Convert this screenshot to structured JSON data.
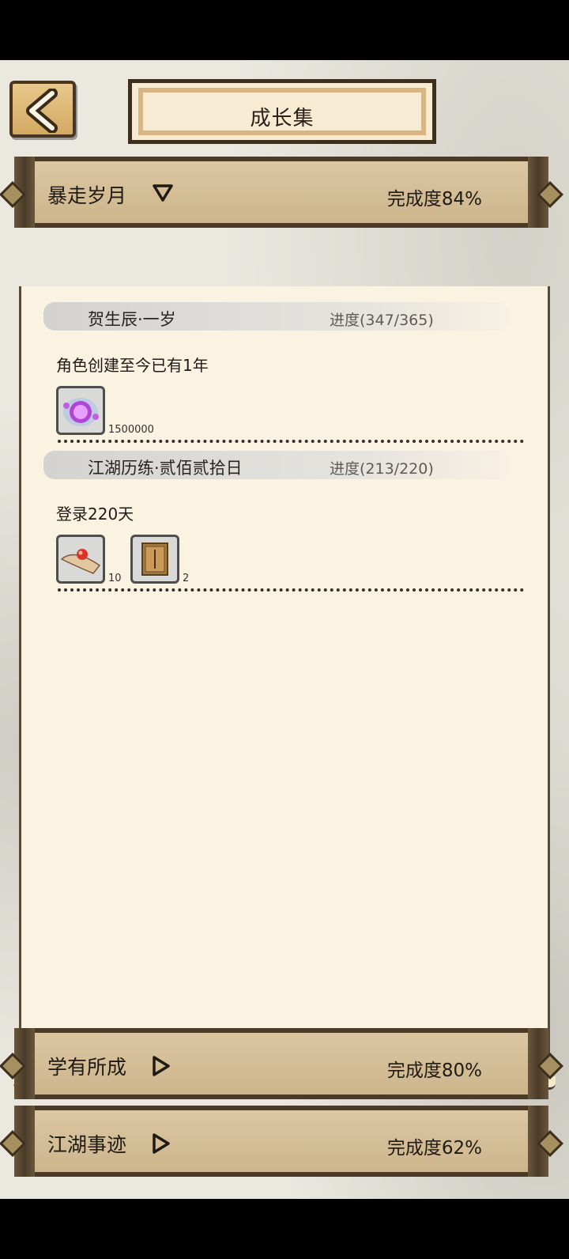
{
  "header": {
    "title": "成长集"
  },
  "sections": [
    {
      "title": "暴走岁月",
      "expanded": true,
      "completion": "完成度84%",
      "tasks": [
        {
          "name": "贺生辰·一岁",
          "progress": "进度(347/365)",
          "description": "角色创建至今已有1年",
          "rewards": [
            {
              "icon": "purple-orb-icon",
              "count": "1500000"
            }
          ]
        },
        {
          "name": "江湖历练·贰佰贰拾日",
          "progress": "进度(213/220)",
          "description": "登录220天",
          "rewards": [
            {
              "icon": "red-pearl-scroll-icon",
              "count": "10"
            },
            {
              "icon": "book-icon",
              "count": "2"
            }
          ]
        }
      ]
    },
    {
      "title": "学有所成",
      "expanded": false,
      "completion": "完成度80%"
    },
    {
      "title": "江湖事迹",
      "expanded": false,
      "completion": "完成度62%"
    }
  ],
  "colors": {
    "parchment": "#fbf3e1",
    "bar": "#d5bf96",
    "frame": "#4b3a26"
  }
}
